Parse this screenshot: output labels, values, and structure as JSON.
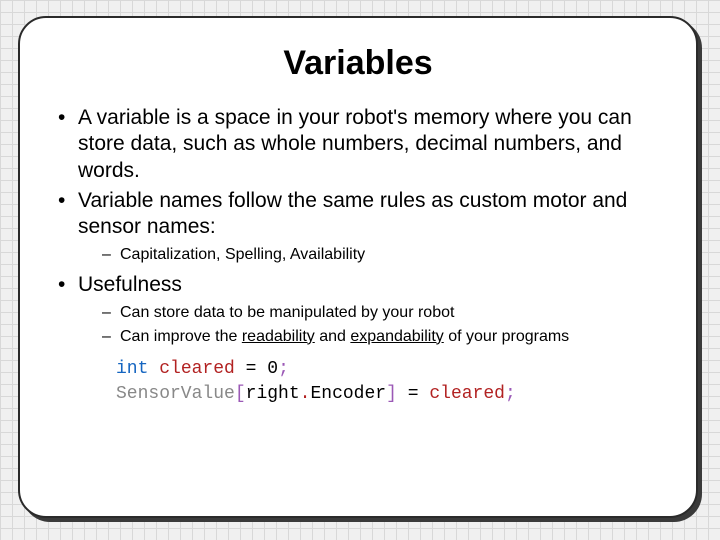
{
  "title": "Variables",
  "bullets": {
    "b1": "A variable is a space in your robot's memory where you can store data, such as whole numbers, decimal numbers, and words.",
    "b2": "Variable names follow the same rules as custom motor and sensor names:",
    "b2_sub1": "Capitalization, Spelling, Availability",
    "b3": "Usefulness",
    "b3_sub1_pre": "Can store data to be manipulated by your robot",
    "b3_sub2_pre": "Can improve the ",
    "b3_sub2_u1": "readability",
    "b3_sub2_mid": " and ",
    "b3_sub2_u2": "expandability",
    "b3_sub2_post": " of your programs"
  },
  "code": {
    "line1": {
      "type": "int",
      "sp1": " ",
      "var": "cleared",
      "sp2": " ",
      "eq": "=",
      "sp3": " ",
      "num": "0",
      "semi": ";"
    },
    "line2": {
      "func": "SensorValue",
      "lbrk": "[",
      "argL": "right",
      "dot": ".",
      "argR": "Encoder",
      "rbrk": "]",
      "sp1": " ",
      "eq": "=",
      "sp2": " ",
      "rhs": "cleared",
      "semi": ";"
    }
  }
}
